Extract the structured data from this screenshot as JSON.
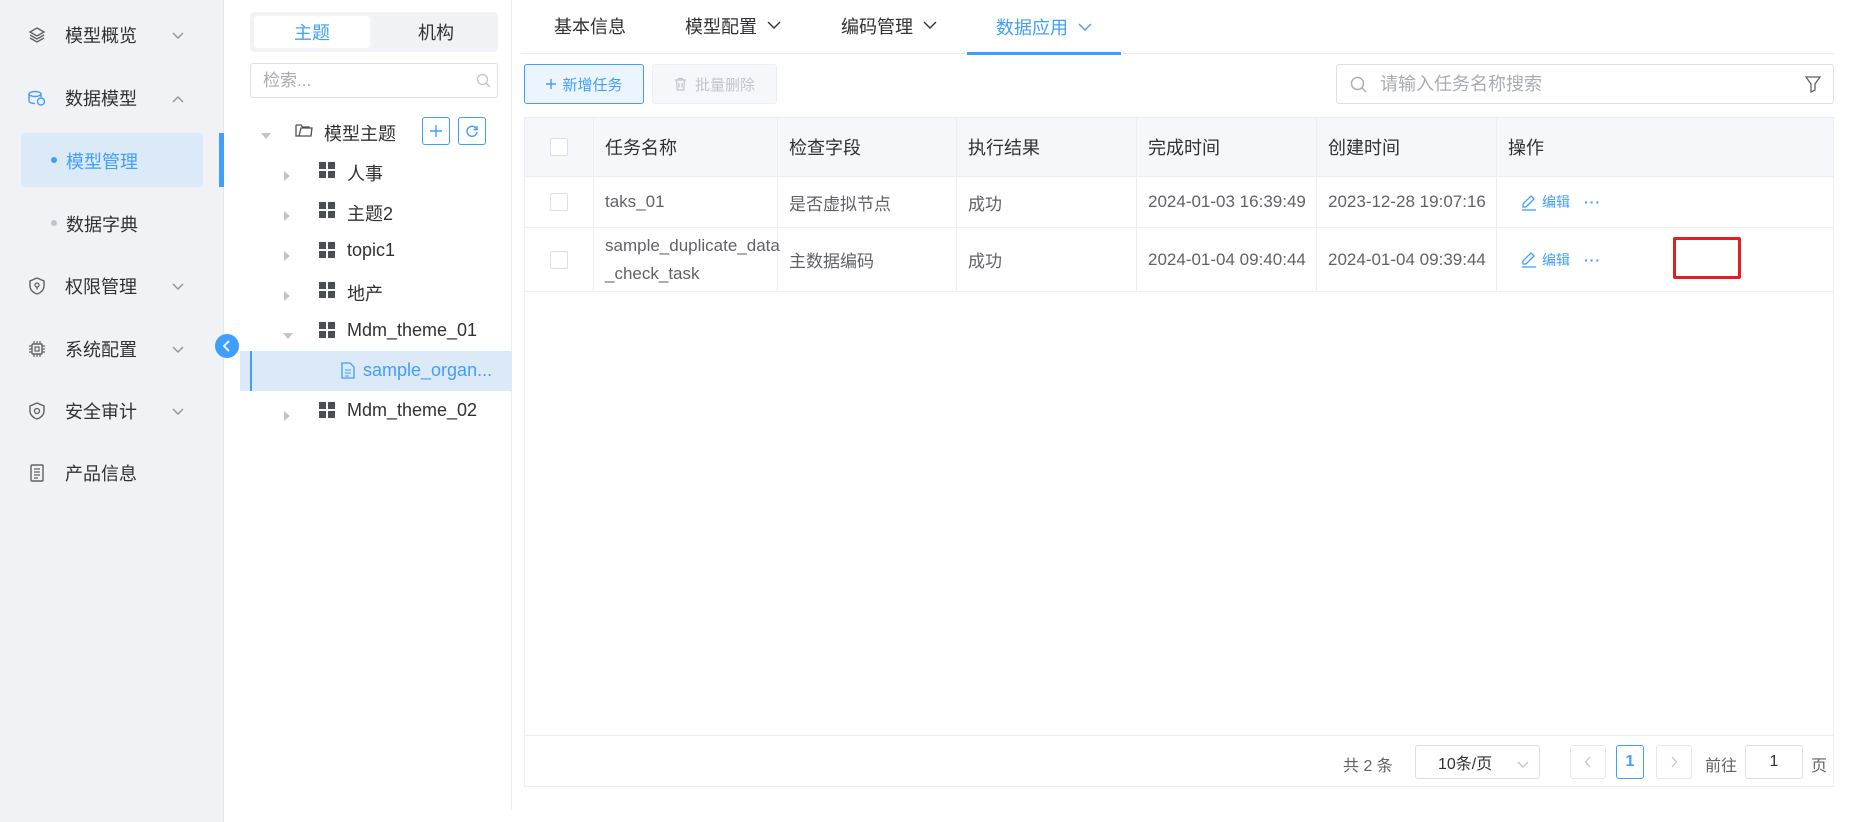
{
  "sidebar": {
    "items": [
      {
        "label": "模型概览",
        "icon": "layers-icon"
      },
      {
        "label": "数据模型",
        "icon": "database-icon"
      },
      {
        "label": "权限管理",
        "icon": "shield-icon"
      },
      {
        "label": "系统配置",
        "icon": "chip-icon"
      },
      {
        "label": "安全审计",
        "icon": "audit-icon"
      },
      {
        "label": "产品信息",
        "icon": "document-icon"
      }
    ],
    "sub_items": [
      {
        "label": "模型管理"
      },
      {
        "label": "数据字典"
      }
    ]
  },
  "tree": {
    "segment": {
      "active": "主题",
      "inactive": "机构"
    },
    "search_placeholder": "检索...",
    "root_label": "模型主题",
    "nodes": [
      {
        "label": "人事"
      },
      {
        "label": "主题2"
      },
      {
        "label": "topic1"
      },
      {
        "label": "地产"
      },
      {
        "label": "Mdm_theme_01"
      },
      {
        "label": "sample_organ..."
      },
      {
        "label": "Mdm_theme_02"
      }
    ]
  },
  "tabs": [
    {
      "label": "基本信息"
    },
    {
      "label": "模型配置"
    },
    {
      "label": "编码管理"
    },
    {
      "label": "数据应用"
    }
  ],
  "toolbar": {
    "add_label": "新增任务",
    "delete_label": "批量删除",
    "search_placeholder": "请输入任务名称搜索"
  },
  "table": {
    "headers": [
      "任务名称",
      "检查字段",
      "执行结果",
      "完成时间",
      "创建时间",
      "操作"
    ],
    "rows": [
      {
        "name": "taks_01",
        "field": "是否虚拟节点",
        "result": "成功",
        "finished": "2024-01-03 16:39:49",
        "created": "2023-12-28 19:07:16",
        "edit": "编辑",
        "more": "···"
      },
      {
        "name": "sample_duplicate_data_check_task",
        "name_line1": "sample_duplicate_data",
        "name_line2": "_check_task",
        "field": "主数据编码",
        "result": "成功",
        "finished": "2024-01-04 09:40:44",
        "created": "2024-01-04 09:39:44",
        "edit": "编辑",
        "more": "···"
      }
    ]
  },
  "pagination": {
    "total": "共 2 条",
    "page_size": "10条/页",
    "current_page": "1",
    "goto_label": "前往",
    "goto_value": "1",
    "page_suffix": "页"
  },
  "colors": {
    "accent": "#409eff",
    "highlight": "#e02020",
    "sidebar_bg": "#f0f2f5"
  }
}
